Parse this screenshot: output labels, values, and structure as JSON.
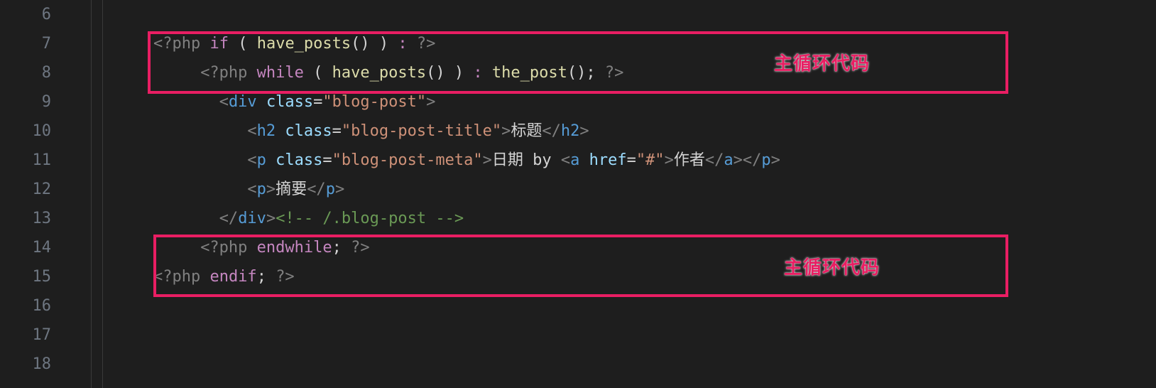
{
  "lineNumbers": [
    "6",
    "7",
    "8",
    "9",
    "10",
    "11",
    "12",
    "13",
    "14",
    "15",
    "16",
    "17",
    "18"
  ],
  "tokens": {
    "phpOpen": "<?php",
    "phpClose": "?>",
    "if": "if",
    "while": "while",
    "endwhile": "endwhile",
    "endif": "endif",
    "have_posts": "have_posts",
    "the_post": "the_post",
    "div": "div",
    "h2": "h2",
    "p": "p",
    "a": "a",
    "class": "class",
    "href": "href",
    "blogPost": "\"blog-post\"",
    "blogPostTitle": "\"blog-post-title\"",
    "blogPostMeta": "\"blog-post-meta\"",
    "hrefHash": "\"#\"",
    "titleText": "标题",
    "dateText": "日期 ",
    "byText": "by ",
    "authorText": "作者",
    "excerptText": "摘要",
    "commentText": "<!-- /.blog-post -->",
    "colon": " : ",
    "semi": ";",
    "lparen": "(",
    "rparen": ")",
    "space": " ",
    "lt": "<",
    "gt": ">",
    "ltSlash": "</",
    "eq": "="
  },
  "annotations": {
    "topLabel": "主循环代码",
    "bottomLabel": "主循环代码"
  }
}
